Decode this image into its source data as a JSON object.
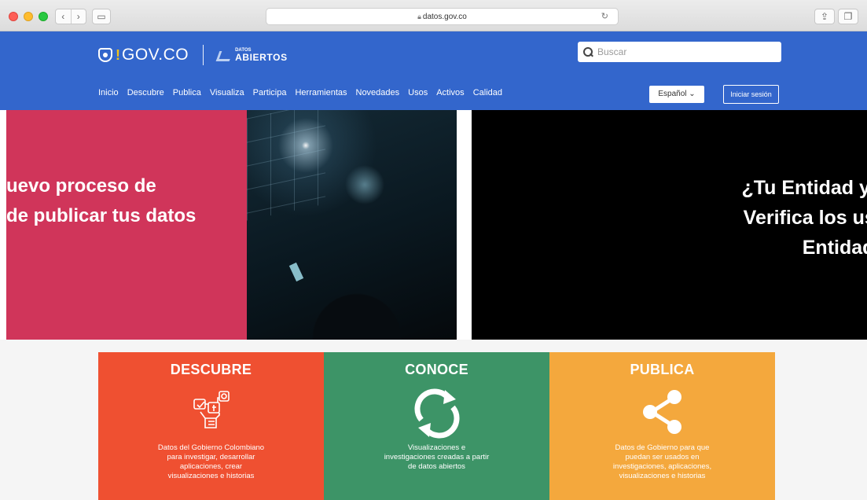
{
  "browser": {
    "url": "datos.gov.co",
    "back_icon": "chevron-left-icon",
    "forward_icon": "chevron-right-icon"
  },
  "header": {
    "gov_logo": "GOV.CO",
    "datos_abiertos_top": "DATOS",
    "datos_abiertos_bottom": "ABIERTOS",
    "search_placeholder": "Buscar",
    "language": "Español",
    "login": "Iniciar sesión",
    "nav": [
      "Inicio",
      "Descubre",
      "Publica",
      "Visualiza",
      "Participa",
      "Herramientas",
      "Novedades",
      "Usos",
      "Activos",
      "Calidad"
    ]
  },
  "banner": {
    "left_line1": "uevo proceso de",
    "left_line2": "de publicar tus datos",
    "right_line1": "¿Tu Entidad ya p",
    "right_line2": "Verifica los usua",
    "right_line3": "Entidad er"
  },
  "features": [
    {
      "title": "DESCUBRE",
      "text": "Datos del Gobierno Colombiano para investigar, desarrollar aplicaciones, crear visualizaciones e historias"
    },
    {
      "title": "CONOCE",
      "text": "Visualizaciones e investigaciones creadas a partir de datos abiertos"
    },
    {
      "title": "PUBLICA",
      "text": "Datos de Gobierno para que puedan ser usados en investigaciones, aplicaciones, visualizaciones e historias"
    }
  ],
  "colors": {
    "header_blue": "#3366cc",
    "descubre": "#ef5031",
    "conoce": "#3d9467",
    "publica": "#f4a83d",
    "banner_pink": "#d0355a"
  }
}
